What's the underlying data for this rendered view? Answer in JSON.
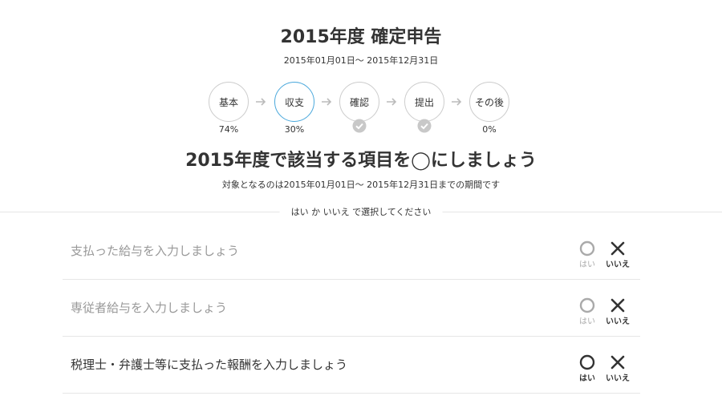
{
  "header": {
    "title": "2015年度 確定申告",
    "period": "2015年01月01日〜 2015年12月31日"
  },
  "steps": [
    {
      "label": "基本",
      "percent": "74%",
      "state": "normal"
    },
    {
      "label": "収支",
      "percent": "30%",
      "state": "active"
    },
    {
      "label": "確認",
      "percent": "",
      "state": "check"
    },
    {
      "label": "提出",
      "percent": "",
      "state": "check"
    },
    {
      "label": "その後",
      "percent": "0%",
      "state": "normal"
    }
  ],
  "section": {
    "title": "2015年度で該当する項目を◯にしましょう",
    "note": "対象となるのは2015年01月01日〜 2015年12月31日までの期間です",
    "instruction": "はい か いいえ で選択してください"
  },
  "questions": [
    {
      "text": "支払った給与を入力しましょう",
      "yes_label": "はい",
      "no_label": "いいえ"
    },
    {
      "text": "専従者給与を入力しましょう",
      "yes_label": "はい",
      "no_label": "いいえ"
    },
    {
      "text": "税理士・弁護士等に支払った報酬を入力しましょう",
      "yes_label": "はい",
      "no_label": "いいえ"
    }
  ],
  "colors": {
    "accent": "#4aa8dc",
    "text": "#333333",
    "muted": "#999999",
    "border": "#cccccc"
  }
}
